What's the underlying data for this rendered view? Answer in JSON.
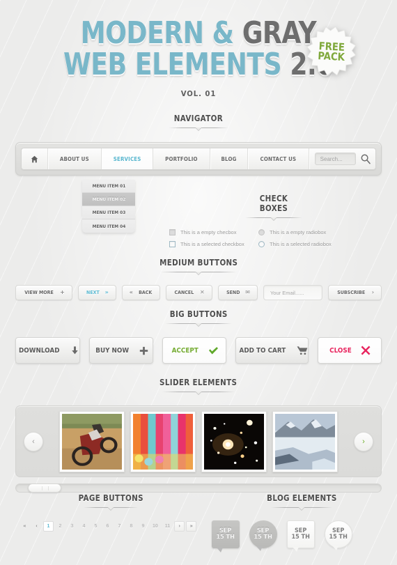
{
  "hero": {
    "line1_a": "MODERN & ",
    "line1_b": "GRAY",
    "line2_a": "WEB ELEMENTS ",
    "line2_b": "2.0",
    "volume": "VOL. 01",
    "badge_line1": "FREE",
    "badge_line2": "PACK",
    "badge_color": "#7fa83b",
    "accent_cyan": "#79b7c9",
    "accent_gray": "#6e6e6e"
  },
  "sections": {
    "navigator": "NAVIGATOR",
    "check_boxes": "CHECK BOXES",
    "medium_buttons": "MEDIUM BUTTONS",
    "big_buttons": "BIG BUTTONS",
    "slider_elements": "SLIDER ELEMENTS",
    "page_buttons": "PAGE BUTTONS",
    "blog_elements": "BLOG ELEMENTS"
  },
  "navigator": {
    "home_icon": "home-icon",
    "items": [
      {
        "label": "ABOUT US",
        "active": false
      },
      {
        "label": "SERVICES",
        "active": true
      },
      {
        "label": "PORTFOLIO",
        "active": false
      },
      {
        "label": "BLOG",
        "active": false
      },
      {
        "label": "CONTACT US",
        "active": false
      }
    ],
    "active_color": "#58b6ce",
    "search": {
      "placeholder": "Search...",
      "value": "",
      "icon": "search-icon"
    }
  },
  "dropdown": {
    "items": [
      {
        "label": "MENU ITEM 01",
        "active": false
      },
      {
        "label": "MENU ITEM 02",
        "active": true
      },
      {
        "label": "MENU ITEM 03",
        "active": false
      },
      {
        "label": "MENU ITEM 04",
        "active": false
      }
    ]
  },
  "checkboxes": {
    "rows": [
      {
        "label": "This is a empty checbox",
        "type": "checkbox",
        "selected": false
      },
      {
        "label": "This is a empty radiobox",
        "type": "radio",
        "selected": false
      },
      {
        "label": "This is a selected checkbox",
        "type": "checkbox",
        "selected": true
      },
      {
        "label": "This is a selected radiobox",
        "type": "radio",
        "selected": true
      }
    ]
  },
  "medium_buttons": [
    {
      "label": "VIEW MORE",
      "icon": "plus-icon",
      "icon_glyph": "+",
      "icon_side": "right",
      "style": "gray"
    },
    {
      "label": "NEXT",
      "icon": "double-right-icon",
      "icon_glyph": "»",
      "icon_side": "right",
      "style": "cyan"
    },
    {
      "label": "BACK",
      "icon": "double-left-icon",
      "icon_glyph": "«",
      "icon_side": "left",
      "style": "gray"
    },
    {
      "label": "CANCEL",
      "icon": "close-x-icon",
      "icon_glyph": "✕",
      "icon_side": "right",
      "style": "gray"
    },
    {
      "label": "SEND",
      "icon": "envelope-icon",
      "icon_glyph": "✉",
      "icon_side": "right",
      "style": "gray"
    }
  ],
  "email_signup": {
    "placeholder": "Your Email......",
    "value": "",
    "button_label": "SUBSCRIBE",
    "button_icon": "chevron-right-icon",
    "button_icon_glyph": "›"
  },
  "big_buttons": [
    {
      "label": "DOWNLOAD",
      "icon": "download-arrow-icon",
      "style": "gray"
    },
    {
      "label": "BUY NOW",
      "icon": "plus-icon",
      "style": "gray"
    },
    {
      "label": "ACCEPT",
      "icon": "check-icon",
      "style": "green"
    },
    {
      "label": "ADD TO CART",
      "icon": "shopping-cart-icon",
      "style": "gray"
    },
    {
      "label": "CLOSE",
      "icon": "close-x-icon",
      "style": "pink"
    }
  ],
  "big_button_colors": {
    "green": "#76ac34",
    "pink": "#e8245e",
    "gray": "#5a5a5a"
  },
  "slider": {
    "prev_icon": "chevron-left-icon",
    "next_icon": "chevron-right-icon",
    "prev_glyph": "‹",
    "next_glyph": "›",
    "next_color": "#6fae2a",
    "slides": [
      {
        "name": "motocross-dirt-bike-photo"
      },
      {
        "name": "colorful-textile-fabric-photo"
      },
      {
        "name": "starfield-galaxy-space-photo"
      },
      {
        "name": "snow-mountain-lake-photo"
      }
    ],
    "scrollbar_position_percent": 3
  },
  "pagination": {
    "first_glyph": "«",
    "prev_glyph": "‹",
    "next_glyph": "›",
    "last_glyph": "»",
    "pages": [
      "1",
      "2",
      "3",
      "4",
      "5",
      "6",
      "7",
      "8",
      "9",
      "10",
      "11"
    ],
    "active_page": "1",
    "active_color": "#5cbad2"
  },
  "blog_badges": [
    {
      "month": "SEP",
      "day": "15 TH",
      "shape": "square",
      "tone": "dark"
    },
    {
      "month": "SEP",
      "day": "15 TH",
      "shape": "circle",
      "tone": "dark"
    },
    {
      "month": "SEP",
      "day": "15 TH",
      "shape": "square",
      "tone": "light"
    },
    {
      "month": "SEP",
      "day": "15 TH",
      "shape": "circle",
      "tone": "light"
    }
  ]
}
